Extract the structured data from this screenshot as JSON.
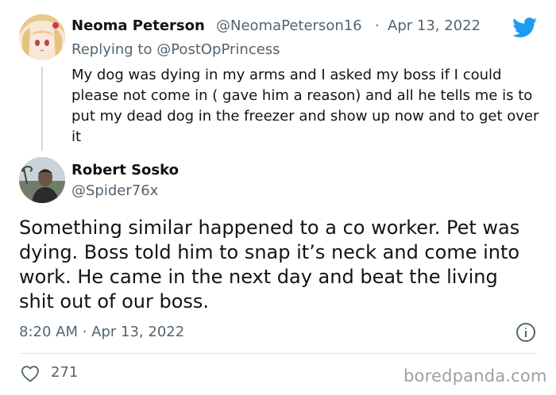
{
  "reply_tweet": {
    "author_name": "Neoma Peterson",
    "handle": "@NeomaPeterson16",
    "separator": "·",
    "date": "Apr 13, 2022",
    "replying_prefix": "Replying to",
    "replying_to": "@PostOpPrincess",
    "text": "My  dog was dying in my arms and I asked my boss if I could please not come in ( gave him a reason) and all he  tells me is to put my dead dog  in the freezer and show up now and to get over it"
  },
  "main_tweet": {
    "author_name": "Robert Sosko",
    "handle": "@Spider76x",
    "text": "Something similar happened to a co worker. Pet was dying. Boss told him to snap it’s neck and come into work. He came in the next day and beat the living shit out of our boss.",
    "timestamp": "8:20 AM · Apr 13, 2022",
    "likes": "271"
  },
  "watermark": "boredpanda.com",
  "icons": {
    "brand": "twitter-bird-icon",
    "info": "info-icon",
    "like": "heart-icon"
  },
  "colors": {
    "twitter_blue": "#1d9bf0",
    "secondary_text": "#536471",
    "primary_text": "#0f1419"
  }
}
